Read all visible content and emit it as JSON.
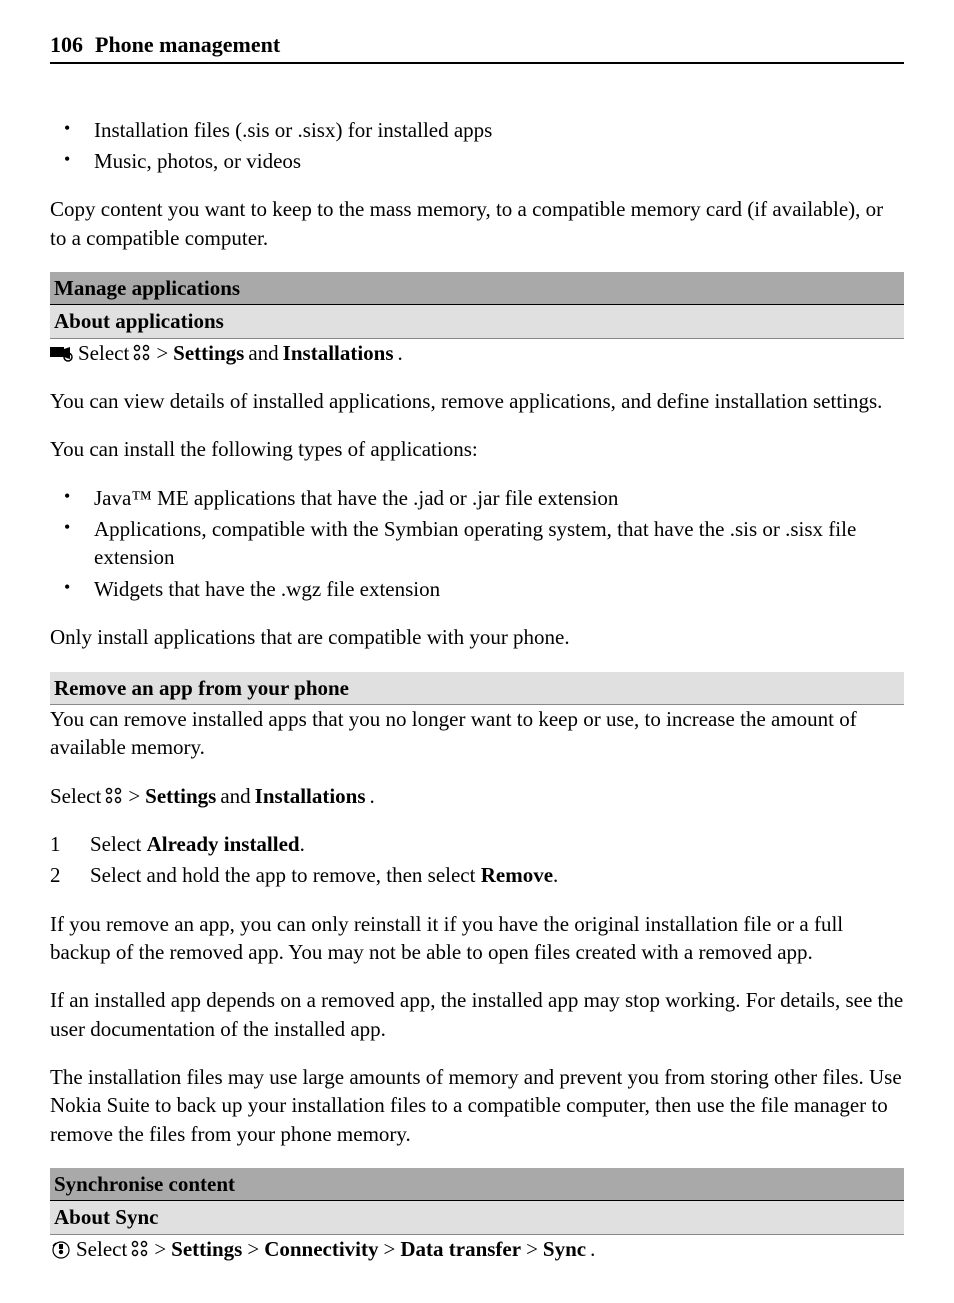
{
  "header": {
    "page_num": "106",
    "title": "Phone management"
  },
  "bullets_top": [
    "Installation files (.sis or .sisx) for installed apps",
    "Music, photos, or videos"
  ],
  "copy_para": "Copy content you want to keep to the mass memory, to a compatible memory card (if available), or to a compatible computer.",
  "section_manage": {
    "title": "Manage applications",
    "subtitle": "About applications",
    "path": {
      "select": "Select",
      "gt": ">",
      "settings": "Settings",
      "and": "and",
      "installations": "Installations",
      "dot": "."
    },
    "para1": "You can view details of installed applications, remove applications, and define installation settings.",
    "para2": "You can install the following types of applications:",
    "bullets": [
      "Java™ ME applications that have the .jad or .jar file extension",
      "Applications, compatible with the Symbian operating system, that have the .sis or .sisx file extension",
      "Widgets that have the .wgz file extension"
    ],
    "para3": "Only install applications that are compatible with your phone."
  },
  "section_remove": {
    "title": "Remove an app from your phone",
    "para1": "You can remove installed apps that you no longer want to keep or use, to increase the amount of available memory.",
    "path": {
      "select": "Select",
      "gt": ">",
      "settings": "Settings",
      "and": "and",
      "installations": "Installations",
      "dot": "."
    },
    "steps": {
      "step1_num": "1",
      "step1_select": "Select ",
      "step1_bold": "Already installed",
      "step1_dot": ".",
      "step2_num": "2",
      "step2_a": "Select and hold the app to remove, then select ",
      "step2_bold": "Remove",
      "step2_dot": "."
    },
    "para2": "If you remove an app, you can only reinstall it if you have the original installation file or a full backup of the removed app. You may not be able to open files created with a removed app.",
    "para3": "If an installed app depends on a removed app, the installed app may stop working. For details, see the user documentation of the installed app.",
    "para4": "The installation files may use large amounts of memory and prevent you from storing other files. Use Nokia Suite to back up your installation files to a compatible computer, then use the file manager to remove the files from your phone memory."
  },
  "section_sync": {
    "title": "Synchronise content",
    "subtitle": "About Sync",
    "path": {
      "select": "Select",
      "gt1": ">",
      "settings": "Settings",
      "gt2": ">",
      "connectivity": "Connectivity",
      "gt3": ">",
      "data_transfer": "Data transfer",
      "gt4": ">",
      "sync": "Sync",
      "dot": "."
    }
  }
}
